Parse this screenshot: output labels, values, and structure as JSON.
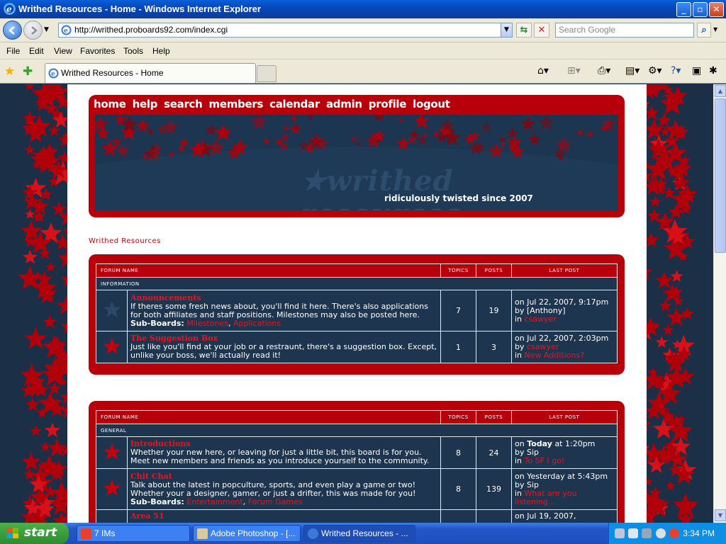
{
  "window": {
    "title": "Writhed Resources - Home - Windows Internet Explorer",
    "minimize": "_",
    "maximize": "▫",
    "close": "✕"
  },
  "address": {
    "url": "http://writhed.proboards92.com/index.cgi",
    "search_placeholder": "Search Google"
  },
  "menu": [
    "File",
    "Edit",
    "View",
    "Favorites",
    "Tools",
    "Help"
  ],
  "tab": {
    "label": "Writhed Resources - Home"
  },
  "forum": {
    "nav": [
      "home",
      "help",
      "search",
      "members",
      "calendar",
      "admin",
      "profile",
      "logout"
    ],
    "logo_text": "★writhed resources",
    "tagline": "ridiculously twisted since 2007",
    "breadcrumb": "Writhed Resources",
    "headers": {
      "name": "Forum Name",
      "topics": "Topics",
      "posts": "Posts",
      "last": "Last Post"
    },
    "categories": [
      {
        "name": "Information",
        "boards": [
          {
            "title": "Announcements",
            "desc": "If theres some fresh news about, you'll find it here. There's also applications for both affiliates and staff positions. Milestones may also be posted here.",
            "subboards_label": "Sub-Boards:",
            "subboards": [
              "Milestones",
              "Applications"
            ],
            "topics": "7",
            "posts": "19",
            "last_on": "on Jul 22, 2007, 9:17pm",
            "last_by": "by [Anthony]",
            "last_in_prefix": "in",
            "last_in": "csawyer"
          },
          {
            "title": "The Suggestion Box",
            "desc": "Just like you'll find at your job or a restraunt, there's a suggestion box. Except, unlike your boss, we'll actually read it!",
            "topics": "1",
            "posts": "3",
            "last_on": "on Jul 22, 2007, 2:03pm",
            "last_by_prefix": "by",
            "last_by": "csawyer",
            "last_in_prefix": "in",
            "last_in": "New Additions?"
          }
        ]
      },
      {
        "name": "General",
        "boards": [
          {
            "title": "Introductions",
            "desc": "Whether your new here, or leaving for just a little bit, this board is for you. Meet new members and friends as you introduce yourself to the community.",
            "topics": "8",
            "posts": "24",
            "last_on_prefix": "on",
            "last_on_bold": "Today",
            "last_on_suffix": "at 1:20pm",
            "last_by": "by Sip",
            "last_in_prefix": "in",
            "last_in": "To SF I go!"
          },
          {
            "title": "Chit Chat",
            "desc": "Talk about the latest in popculture, sports, and even play a game or two! Whether your a designer, gamer, or just a drifter, this was made for you!",
            "subboards_label": "Sub-Boards:",
            "subboards": [
              "Entertainment",
              "Forum Games"
            ],
            "topics": "8",
            "posts": "139",
            "last_on": "on Yesterday at 5:43pm",
            "last_by": "by Sip",
            "last_in_prefix": "in",
            "last_in": "What are you listening..."
          },
          {
            "title": "Area 51",
            "last_on": "on Jul 19, 2007,"
          }
        ]
      }
    ]
  },
  "taskbar": {
    "start": "start",
    "items": [
      "7 IMs",
      "Adobe Photoshop - [...",
      "Writhed Resources - ..."
    ],
    "clock": "3:34 PM"
  },
  "colors": {
    "forum_red": "#b8000b",
    "forum_navy": "#1e3550",
    "link_red": "#e8141e"
  }
}
